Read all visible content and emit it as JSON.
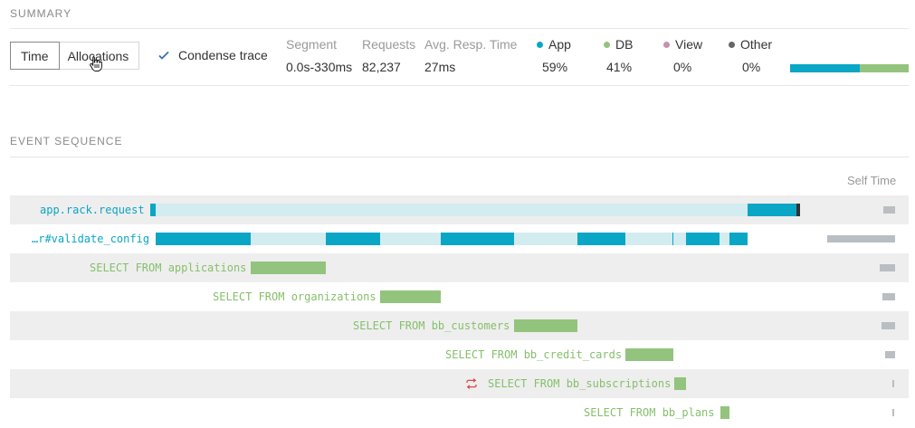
{
  "summary": {
    "title": "SUMMARY",
    "mode_buttons": [
      "Time",
      "Allocations"
    ],
    "condense_label": "Condense trace",
    "condense_checked": true,
    "stats": [
      {
        "label": "Segment",
        "value": "0.0s-330ms"
      },
      {
        "label": "Requests",
        "value": "82,237"
      },
      {
        "label": "Avg. Resp. Time",
        "value": "27ms"
      }
    ],
    "breakdown": [
      {
        "label": "App",
        "value": "59%",
        "color": "#0aa6c6"
      },
      {
        "label": "DB",
        "value": "41%",
        "color": "#93c47d"
      },
      {
        "label": "View",
        "value": "0%",
        "color": "#c690b0"
      },
      {
        "label": "Other",
        "value": "0%",
        "color": "#666666"
      }
    ],
    "breakdown_fraction": {
      "app": 0.59,
      "db": 0.41
    }
  },
  "events": {
    "title": "EVENT SEQUENCE",
    "self_time_label": "Self Time",
    "rows": [
      {
        "label": "app.rack.request",
        "kind": "app"
      },
      {
        "label": "…r#validate_config",
        "kind": "app"
      },
      {
        "label": "SELECT FROM applications",
        "kind": "db"
      },
      {
        "label": "SELECT FROM organizations",
        "kind": "db"
      },
      {
        "label": "SELECT FROM bb_customers",
        "kind": "db"
      },
      {
        "label": "SELECT FROM bb_credit_cards",
        "kind": "db"
      },
      {
        "label": "SELECT FROM bb_subscriptions",
        "kind": "db",
        "repeated": true
      },
      {
        "label": "SELECT FROM bb_plans",
        "kind": "db"
      }
    ]
  },
  "colors": {
    "app": "#0aa6c6",
    "app_light": "#d2ecf0",
    "db": "#93c47d",
    "repeat": "#e04848"
  }
}
